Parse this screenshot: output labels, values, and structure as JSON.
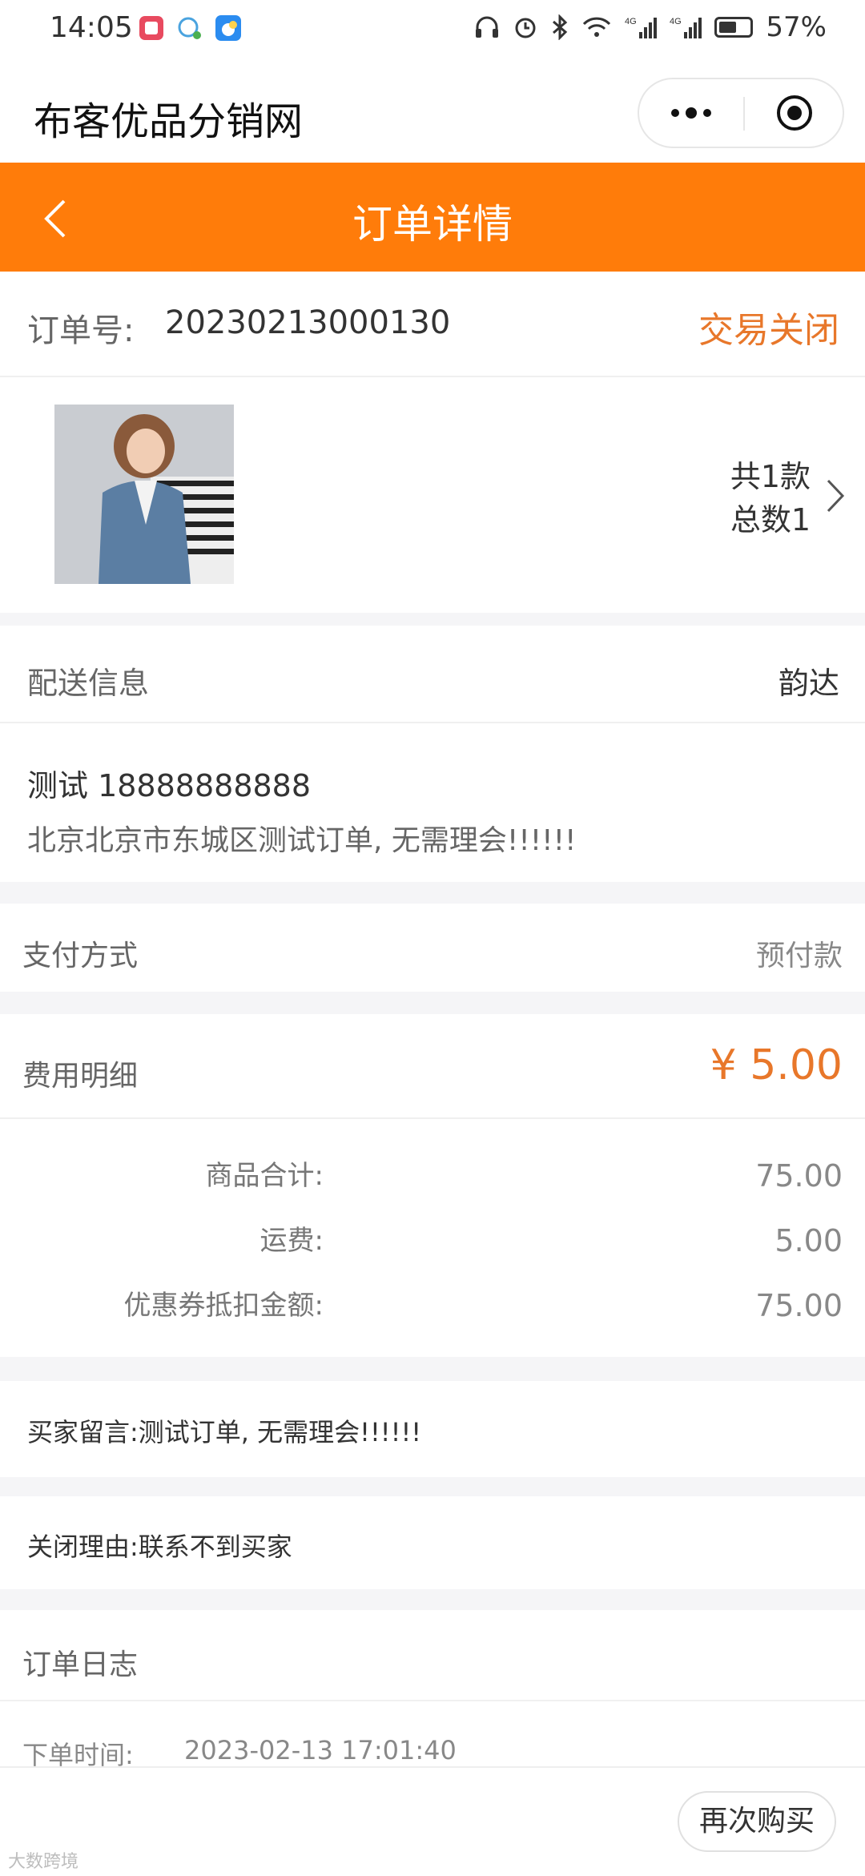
{
  "status": {
    "time": "14:05",
    "battery": "57%",
    "battery_level": 0.57
  },
  "app": {
    "title": "布客优品分销网"
  },
  "nav": {
    "title": "订单详情"
  },
  "order": {
    "number_label": "订单号:",
    "number": "20230213000130",
    "status": "交易关闭"
  },
  "goods": {
    "kinds": "共1款",
    "total": "总数1"
  },
  "delivery": {
    "label": "配送信息",
    "carrier": "韵达",
    "name_phone": "测试 18888888888",
    "address": "北京北京市东城区测试订单, 无需理会!!!!!!"
  },
  "payment": {
    "label": "支付方式",
    "method": "预付款"
  },
  "fees": {
    "label": "费用明细",
    "total": "¥ 5.00",
    "rows": [
      {
        "label": "商品合计:",
        "value": "75.00"
      },
      {
        "label": "运费:",
        "value": "5.00"
      },
      {
        "label": "优惠券抵扣金额:",
        "value": "75.00"
      }
    ]
  },
  "message": {
    "text": "买家留言:测试订单, 无需理会!!!!!!"
  },
  "close": {
    "text": "关闭理由:联系不到买家"
  },
  "log": {
    "label": "订单日志",
    "time_label": "下单时间:",
    "time": "2023-02-13 17:01:40"
  },
  "actions": {
    "buy_again": "再次购买"
  },
  "watermark": "大数跨境",
  "colors": {
    "accent": "#ff7c0a",
    "status_orange": "#e8772a"
  }
}
